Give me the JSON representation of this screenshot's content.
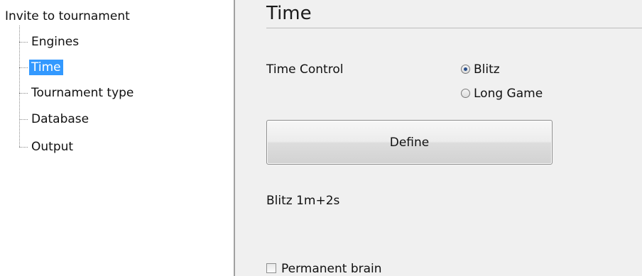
{
  "tree": {
    "root_label": "Invite to tournament",
    "items": [
      {
        "label": "Engines",
        "selected": false
      },
      {
        "label": "Time",
        "selected": true
      },
      {
        "label": "Tournament type",
        "selected": false
      },
      {
        "label": "Database",
        "selected": false
      },
      {
        "label": "Output",
        "selected": false
      }
    ]
  },
  "page": {
    "title": "Time",
    "time_control_label": "Time Control",
    "time_control_options": [
      {
        "label": "Blitz",
        "checked": true
      },
      {
        "label": "Long Game",
        "checked": false
      }
    ],
    "define_label": "Define",
    "summary": "Blitz 1m+2s",
    "permanent_brain": {
      "label": "Permanent brain",
      "checked": false
    }
  },
  "colors": {
    "selection": "#3399ff",
    "pane_background": "#f0f0f0"
  }
}
